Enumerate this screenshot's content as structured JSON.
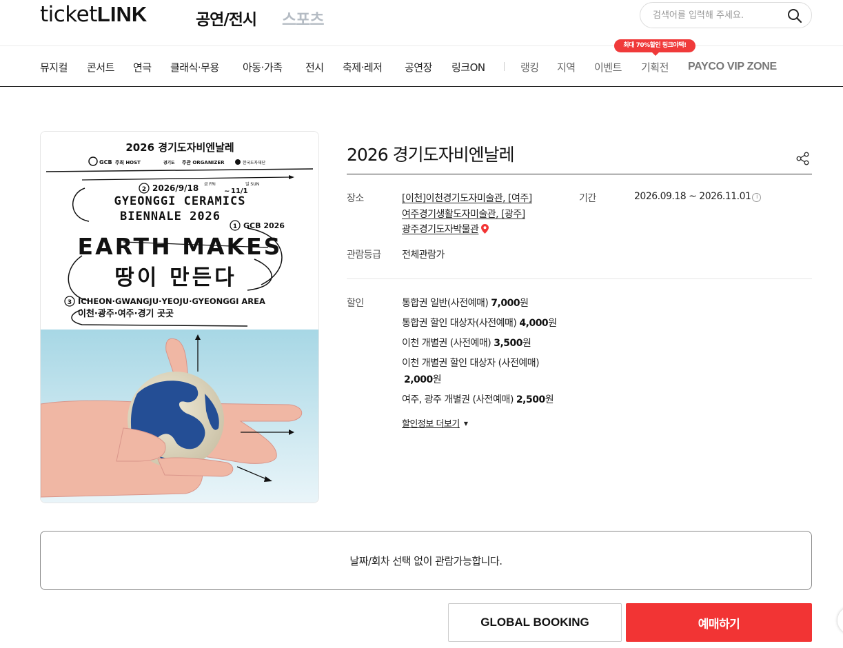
{
  "header": {
    "logo_part1": "ticket",
    "logo_part2": "LINK",
    "tab_active": "공연/전시",
    "tab_inactive": "스포츠",
    "search_placeholder": "검색어를 입력해 주세요."
  },
  "nav": {
    "categories": [
      "뮤지컬",
      "콘서트",
      "연극",
      "클래식·무용",
      "아동·가족",
      "전시",
      "축제·레저",
      "공연장",
      "링크ON"
    ],
    "sub": [
      "랭킹",
      "지역",
      "이벤트",
      "기획전"
    ],
    "payco": "PAYCO VIP ZONE",
    "promo_badge": "최대 70%할인 링크야택!"
  },
  "poster": {
    "title_kr": "2026 경기도자비엔날레",
    "logo_gcb": "GCB",
    "host_label": "주최 HOST",
    "host_org": "경기도",
    "organizer_label": "주관 ORGANIZER",
    "organizer_org": "한국도자재단",
    "date_start": "2026/9/18",
    "date_start_day": "금 FRI",
    "date_end": "11/1",
    "date_end_day": "일 SUN",
    "line_en1": "GYEONGGI CERAMICS",
    "line_en2": "BIENNALE 2026",
    "gcb_year": "GCB 2026",
    "headline_en": "EARTH MAKES",
    "headline_kr": "땅이 만든다",
    "area_en": "ICHEON·GWANGJU·YEOJU·GYEONGGI AREA",
    "area_kr": "이천·광주·여주·경기 곳곳",
    "num1": "1",
    "num2": "2",
    "num3": "3"
  },
  "detail": {
    "title": "2026 경기도자비엔날레",
    "venue_label": "장소",
    "venue_lines": [
      "[이천]이천경기도자미술관, [여주]",
      "여주경기생활도자미술관, [광주]",
      "광주경기도자박물관"
    ],
    "period_label": "기간",
    "period_value": "2026.09.18 ~ 2026.11.01",
    "rating_label": "관람등급",
    "rating_value": "전체관람가",
    "discount_label": "할인",
    "prices": [
      {
        "name": "통합권 일반(사전예매)",
        "amount": "7,000",
        "unit": "원"
      },
      {
        "name": "통합권 할인 대상자(사전예매)",
        "amount": "4,000",
        "unit": "원"
      },
      {
        "name": "이천 개별권 (사전예매)",
        "amount": "3,500",
        "unit": "원"
      },
      {
        "name": "이천 개별권 할인 대상자 (사전예매)",
        "amount": "2,000",
        "unit": "원"
      },
      {
        "name": "여주, 광주 개별권 (사전예매)",
        "amount": "2,500",
        "unit": "원"
      }
    ],
    "more_discount": "할인정보 더보기"
  },
  "notice_text": "날짜/회차 선택 없이 관람가능합니다.",
  "buttons": {
    "global": "GLOBAL BOOKING",
    "book": "예매하기"
  },
  "colors": {
    "accent": "#f23434",
    "poster_sky": "#a8d8e6"
  },
  "icons": [
    "search-icon",
    "share-icon",
    "map-pin-icon",
    "info-icon",
    "dropdown-triangle-icon"
  ]
}
